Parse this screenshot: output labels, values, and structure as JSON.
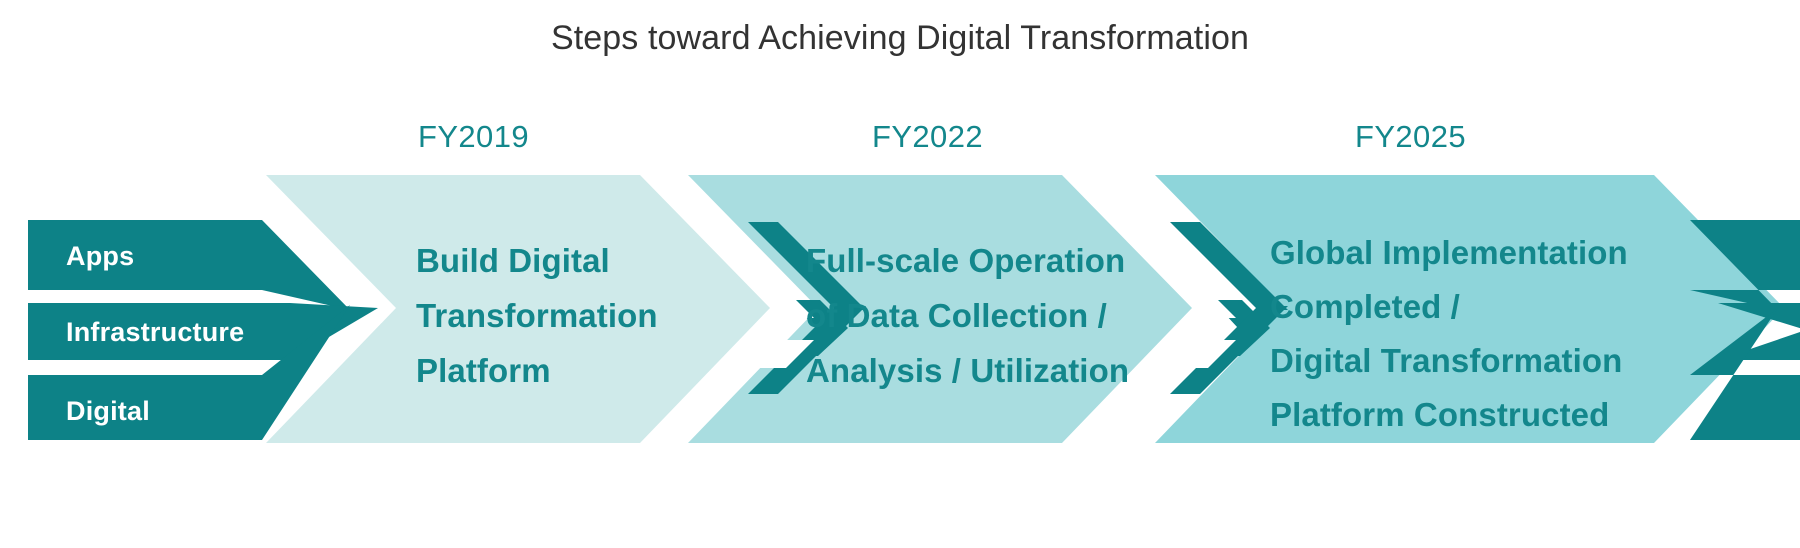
{
  "title": "Steps toward Achieving Digital Transformation",
  "colors": {
    "dark_teal": "#0d8287",
    "phase1_fill": "#cfeaea",
    "phase2_fill": "#a9dde0",
    "phase3_fill": "#8ed5da",
    "text_teal": "#13878c",
    "title_color": "#333333",
    "background": "#ffffff"
  },
  "categories": [
    {
      "label": "Apps"
    },
    {
      "label": "Infrastructure"
    },
    {
      "label": "Digital"
    }
  ],
  "phases": [
    {
      "year": "FY2019",
      "lines": [
        "Build Digital",
        "Transformation",
        "Platform"
      ]
    },
    {
      "year": "FY2022",
      "lines": [
        "Full-scale Operation",
        "of Data Collection /",
        "Analysis / Utilization"
      ]
    },
    {
      "year": "FY2025",
      "lines": [
        "Global Implementation",
        "Completed /",
        "Digital Transformation",
        "Platform Constructed"
      ]
    }
  ]
}
